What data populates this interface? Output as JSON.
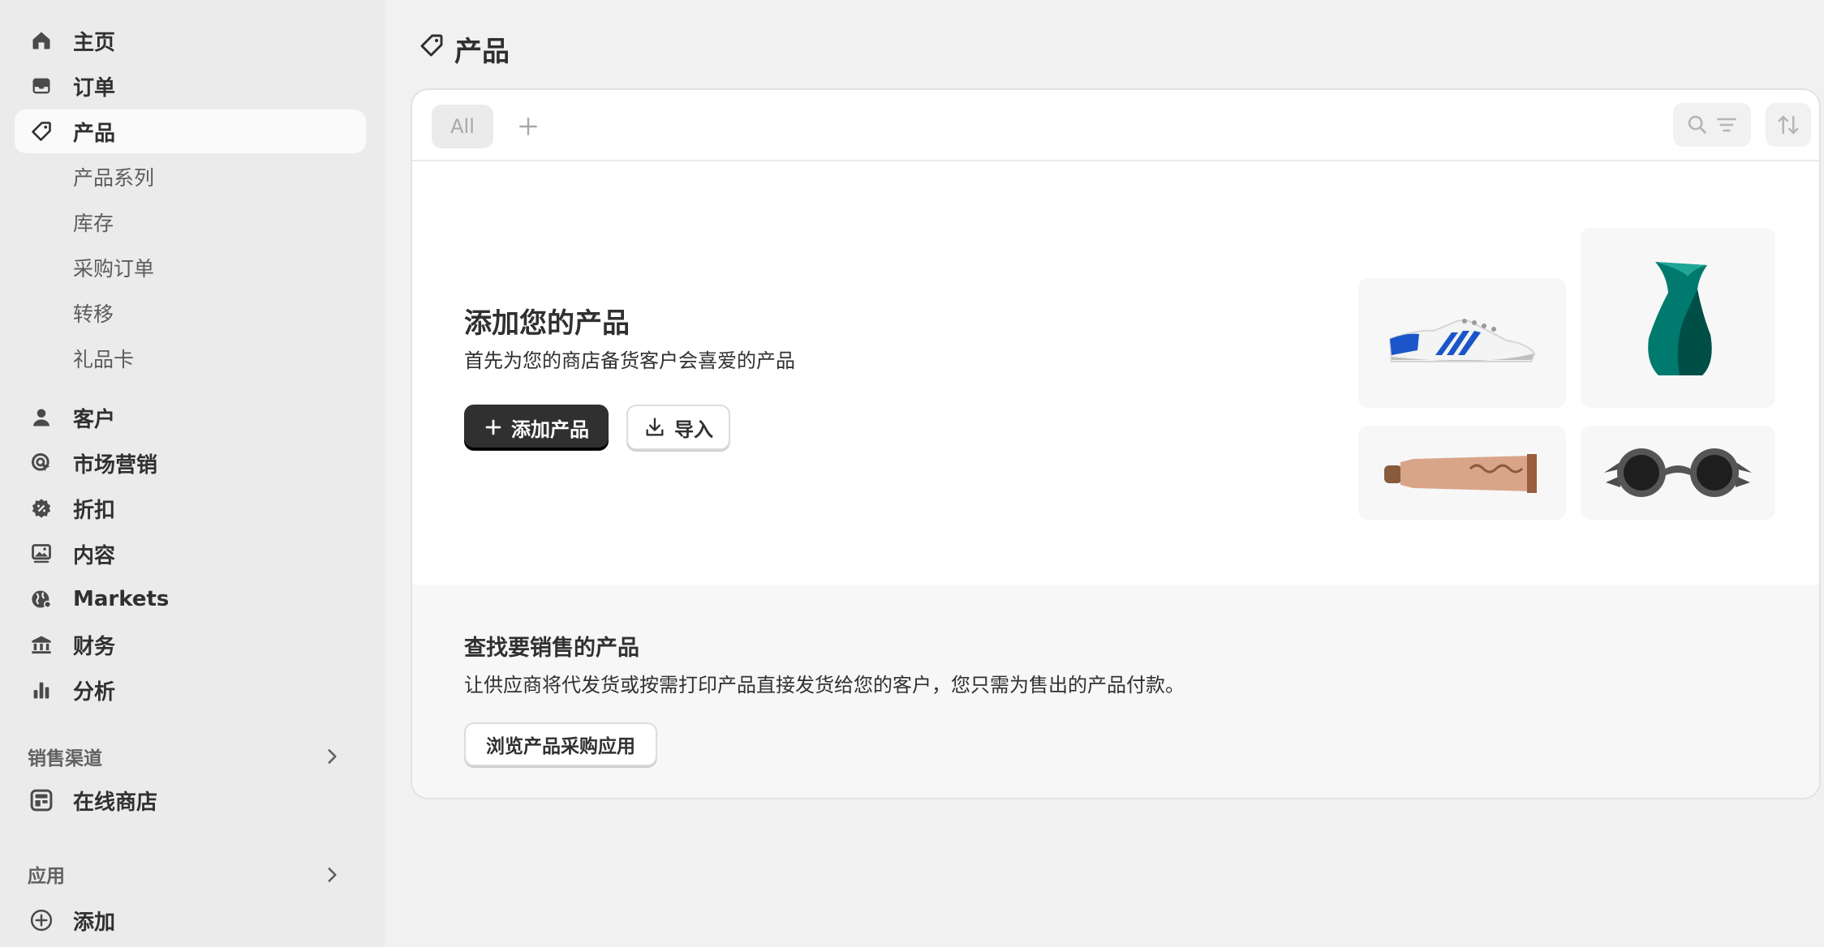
{
  "sidebar": {
    "main_items": [
      {
        "label": "主页",
        "icon": "home-icon"
      },
      {
        "label": "订单",
        "icon": "inbox-icon"
      },
      {
        "label": "产品",
        "icon": "tag-icon",
        "active": true
      }
    ],
    "product_subitems": [
      "产品系列",
      "库存",
      "采购订单",
      "转移",
      "礼品卡"
    ],
    "more_items": [
      {
        "label": "客户",
        "icon": "person-icon"
      },
      {
        "label": "市场营销",
        "icon": "target-icon"
      },
      {
        "label": "折扣",
        "icon": "discount-icon"
      },
      {
        "label": "内容",
        "icon": "image-icon"
      },
      {
        "label": "Markets",
        "icon": "globe-icon"
      },
      {
        "label": "财务",
        "icon": "bank-icon"
      },
      {
        "label": "分析",
        "icon": "bar-chart-icon"
      }
    ],
    "sales_channels": {
      "title": "销售渠道",
      "items": [
        {
          "label": "在线商店",
          "icon": "store-icon"
        }
      ]
    },
    "apps": {
      "title": "应用",
      "add_label": "添加"
    }
  },
  "page": {
    "title": "产品",
    "title_icon": "tag-icon"
  },
  "toolbar": {
    "tab_all": "All"
  },
  "empty_state": {
    "title": "添加您的产品",
    "subtitle": "首先为您的商店备货客户会喜爱的产品",
    "add_button": "添加产品",
    "import_button": "导入",
    "illustrations": [
      "sneaker-illustration",
      "vase-illustration",
      "tube-illustration",
      "sunglasses-illustration"
    ]
  },
  "sourcing": {
    "title": "查找要销售的产品",
    "subtitle": "让供应商将代发货或按需打印产品直接发货给您的客户，您只需为售出的产品付款。",
    "button": "浏览产品采购应用"
  },
  "colors": {
    "primary_button": "#303030",
    "active_nav": "#fafafa",
    "sidebar_bg": "#ebebeb",
    "page_bg": "#f1f1f1"
  }
}
